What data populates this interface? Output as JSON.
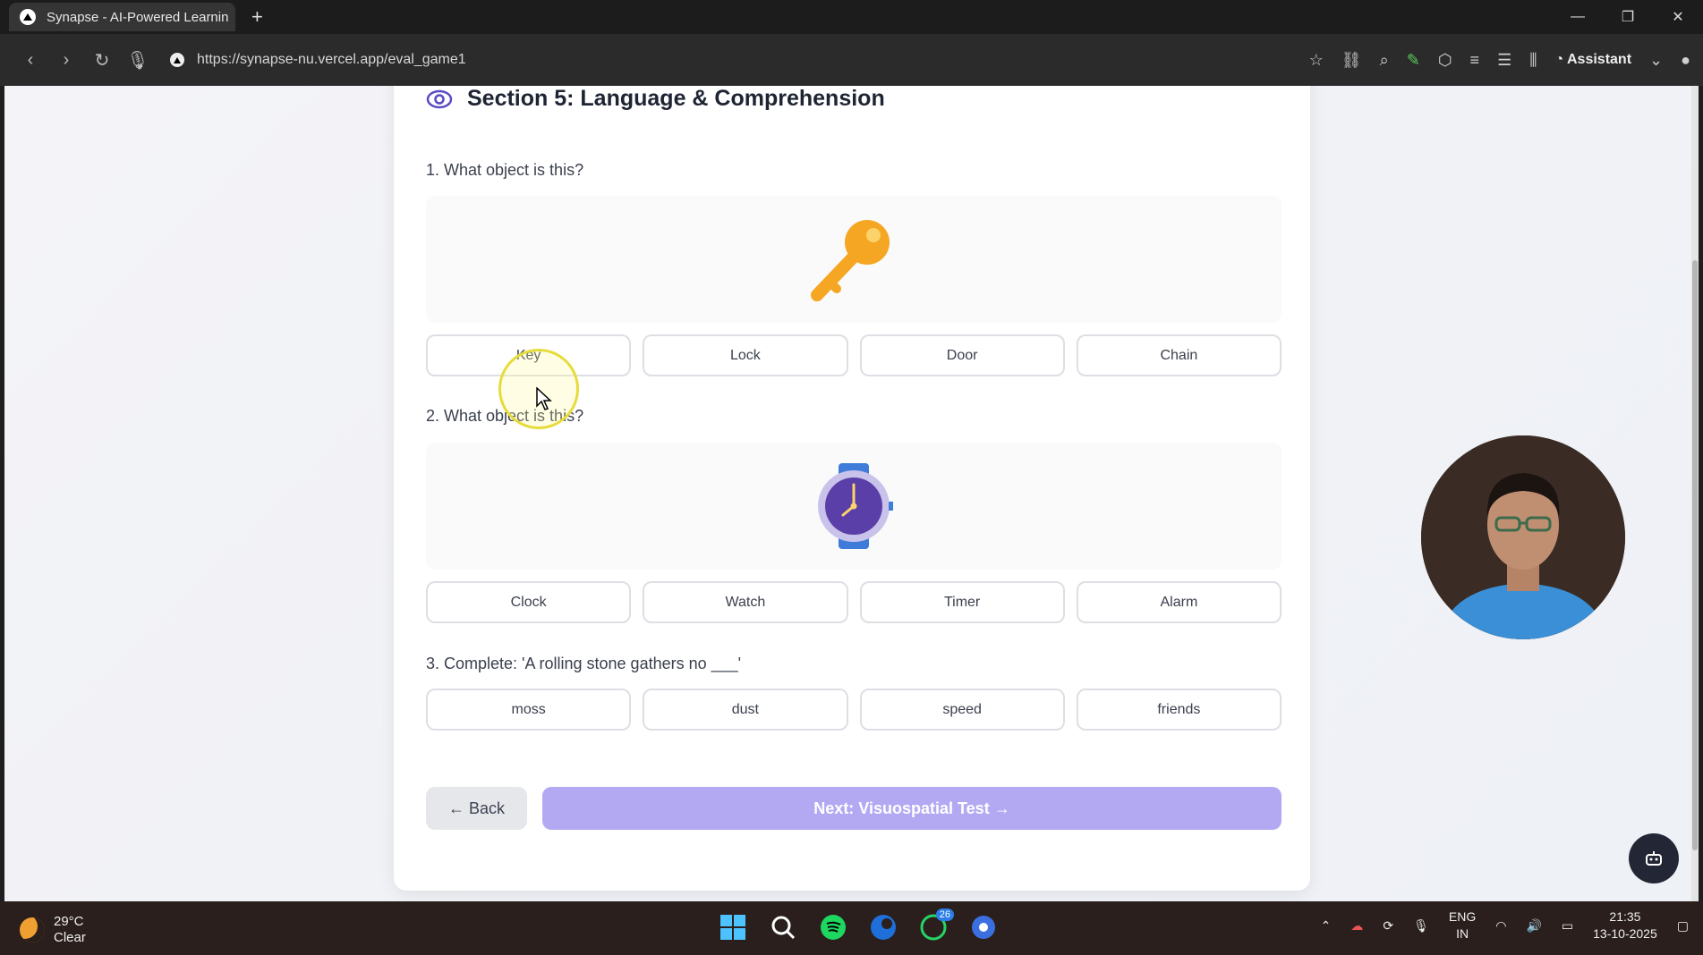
{
  "browser": {
    "tab_title": "Synapse - AI-Powered Learnin",
    "url": "https://synapse-nu.vercel.app/eval_game1",
    "assistant_label": "Assistant"
  },
  "section": {
    "title": "Section 5: Language & Comprehension"
  },
  "questions": [
    {
      "label": "1. What object is this?",
      "image": "key-icon",
      "options": [
        "Key",
        "Lock",
        "Door",
        "Chain"
      ]
    },
    {
      "label": "2. What object is this?",
      "image": "watch-icon",
      "options": [
        "Clock",
        "Watch",
        "Timer",
        "Alarm"
      ]
    },
    {
      "label": "3. Complete: 'A rolling stone gathers no ___'",
      "options": [
        "moss",
        "dust",
        "speed",
        "friends"
      ]
    }
  ],
  "nav": {
    "back_label": "← Back",
    "next_label": "Next: Visuospatial Test →"
  },
  "taskbar": {
    "temperature": "29°C",
    "weather": "Clear",
    "lang_line1": "ENG",
    "lang_line2": "IN",
    "time": "21:35",
    "date": "13-10-2025",
    "whatsapp_badge": "26"
  },
  "colors": {
    "accent": "#b3a9f3",
    "key": "#f5a623",
    "watch_face": "#5b3fa8",
    "watch_band": "#3f7bd9"
  }
}
